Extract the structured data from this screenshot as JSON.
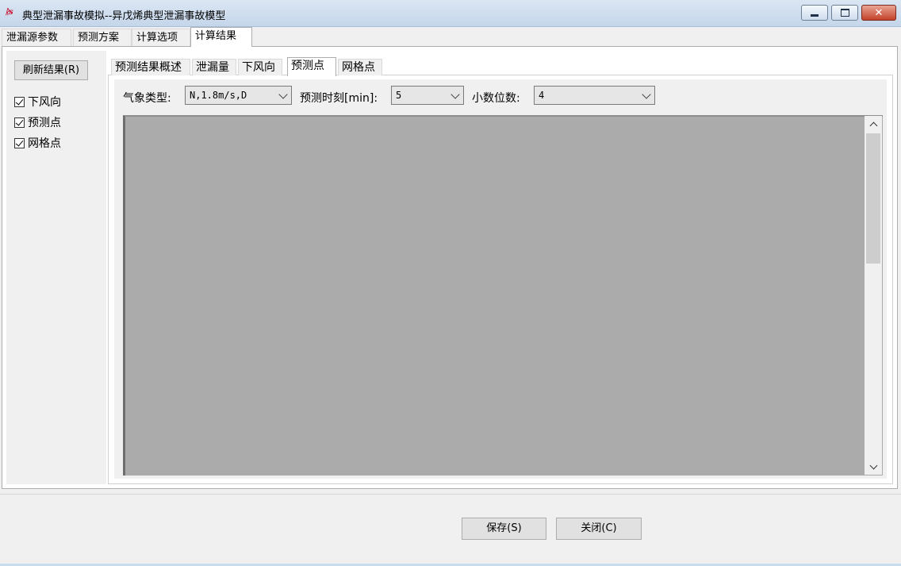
{
  "window": {
    "title": "典型泄漏事故模拟--异戊烯典型泄漏事故模型",
    "icon": "app-logo-icon",
    "min_glyph": "minimize-icon",
    "max_glyph": "maximize-icon",
    "close_glyph": "✕"
  },
  "main_tabs": [
    {
      "label": "泄漏源参数"
    },
    {
      "label": "预测方案"
    },
    {
      "label": "计算选项"
    },
    {
      "label": "计算结果",
      "active": true
    }
  ],
  "left": {
    "refresh_label": "刷新结果(R)",
    "checkboxes": [
      {
        "label": "下风向",
        "checked": true
      },
      {
        "label": "预测点",
        "checked": true
      },
      {
        "label": "网格点",
        "checked": true
      }
    ]
  },
  "sub_tabs": [
    {
      "label": "预测结果概述"
    },
    {
      "label": "泄漏量"
    },
    {
      "label": "下风向"
    },
    {
      "label": "预测点",
      "active": true
    },
    {
      "label": "网格点"
    }
  ],
  "filters": {
    "weather_label": "气象类型:",
    "weather_value": "N,1.8m/s,D",
    "time_label": "预测时刻[min]:",
    "time_value": "5",
    "decimals_label": "小数位数:",
    "decimals_value": "4"
  },
  "buttons": {
    "save_label": "保存(S)",
    "close_label": "关闭(C)"
  },
  "colors": {
    "viewport": "#ababab",
    "close_button": "#c4422a"
  }
}
